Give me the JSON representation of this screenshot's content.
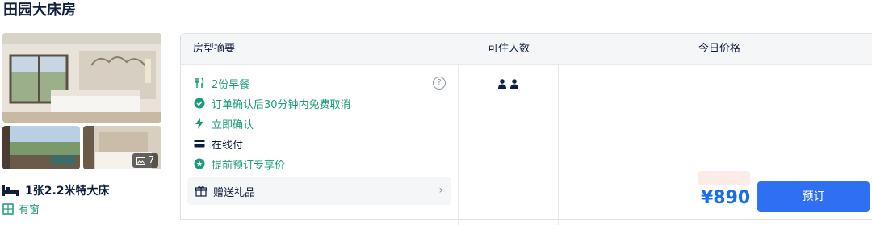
{
  "room": {
    "title": "田园大床房",
    "photo_count": "7",
    "bed": "1张2.2米特大床",
    "window": "有窗"
  },
  "table": {
    "headers": {
      "summary": "房型摘要",
      "guests": "可住人数",
      "price": "今日价格"
    },
    "benefits": [
      {
        "icon": "fork-knife-icon",
        "text": "2份早餐",
        "color": "#1a9c7b"
      },
      {
        "icon": "check-circle-icon",
        "text": "订单确认后30分钟内免费取消",
        "color": "#1a9c7b"
      },
      {
        "icon": "lightning-icon",
        "text": "立即确认",
        "color": "#1a9c7b"
      },
      {
        "icon": "card-icon",
        "text": "在线付",
        "color": "#0f1f3d"
      },
      {
        "icon": "star-badge-icon",
        "text": "提前预订专享价",
        "color": "#1a9c7b"
      }
    ],
    "gift": "赠送礼品",
    "guests_icon": "two-person-icon",
    "price": "¥890",
    "book_label": "预订"
  },
  "colors": {
    "accent_green": "#1a9c7b",
    "accent_blue": "#2f6ff2",
    "price_blue": "#1a6fe8"
  }
}
